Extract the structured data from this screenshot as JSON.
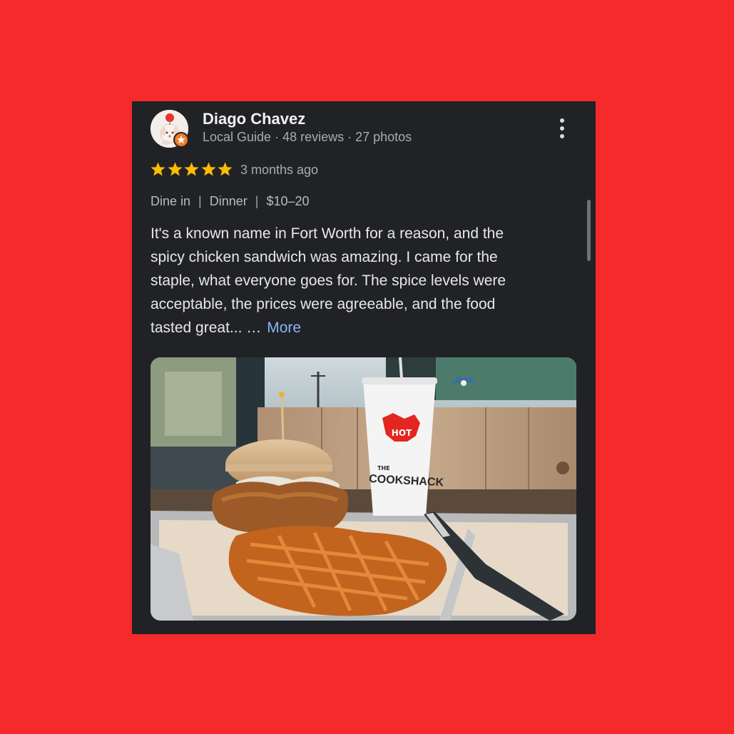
{
  "review": {
    "author": "Diago Chavez",
    "meta": "Local Guide · 48 reviews · 27 photos",
    "rating": 5,
    "time": "3 months ago",
    "tags": [
      "Dine in",
      "Dinner",
      "$10–20"
    ],
    "tag_separator": "|",
    "text_lines": [
      "It's a known name in Fort Worth for a reason, and the",
      "spicy chicken sandwich was amazing. I came for the",
      "staple, what everyone goes for. The spice levels were",
      "acceptable, the prices were agreeable, and the food",
      "tasted great... …"
    ],
    "more_label": "More"
  },
  "photo": {
    "cup_hot_text": "HOT",
    "cup_the_text": "THE",
    "cup_brand_text": "COOKSHACK"
  },
  "colors": {
    "background": "#f52a2a",
    "card": "#212226",
    "star": "#fbbc04",
    "link": "#8ab4f8",
    "guide_badge": "#f07b2a"
  },
  "icons": {
    "menu": "more-vert-icon",
    "badge": "local-guide-star-icon",
    "rating": "star-icon"
  }
}
